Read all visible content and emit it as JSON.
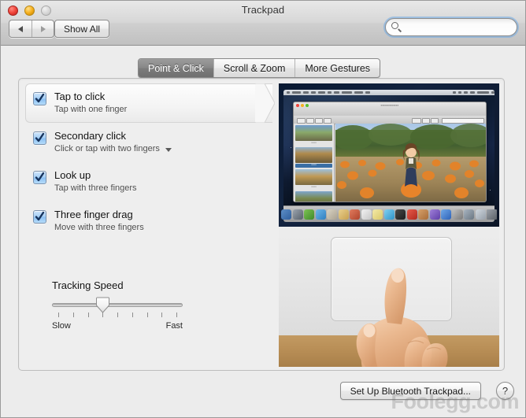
{
  "window": {
    "title": "Trackpad",
    "traffic_lights": [
      "close",
      "minimize",
      "zoom"
    ]
  },
  "toolbar": {
    "back_label": "Back",
    "forward_label": "Forward",
    "show_all_label": "Show All",
    "search": {
      "value": "",
      "placeholder": "",
      "icon": "search-icon"
    }
  },
  "tabs": [
    {
      "label": "Point & Click",
      "active": true
    },
    {
      "label": "Scroll & Zoom",
      "active": false
    },
    {
      "label": "More Gestures",
      "active": false
    }
  ],
  "options": [
    {
      "title": "Tap to click",
      "subtitle": "Tap with one finger",
      "checked": true,
      "selected": true,
      "has_popup": false
    },
    {
      "title": "Secondary click",
      "subtitle": "Click or tap with two fingers",
      "checked": true,
      "selected": false,
      "has_popup": true
    },
    {
      "title": "Look up",
      "subtitle": "Tap with three fingers",
      "checked": true,
      "selected": false,
      "has_popup": false
    },
    {
      "title": "Three finger drag",
      "subtitle": "Move with three fingers",
      "checked": true,
      "selected": false,
      "has_popup": false
    }
  ],
  "tracking_speed": {
    "label": "Tracking Speed",
    "min_label": "Slow",
    "max_label": "Fast",
    "tick_count": 9,
    "value_index": 3
  },
  "preview": {
    "top_scene": "mac-desktop-preview-app-pumpkin-patch-photo",
    "bottom_scene": "hand-tapping-magic-trackpad"
  },
  "buttons": {
    "bluetooth_label": "Set Up Bluetooth Trackpad...",
    "help_label": "?"
  },
  "watermark": "Foolegg.com",
  "colors": {
    "window_bg": "#ececec",
    "content_bg": "#eeeeee",
    "accent_checkbox": "#8cc0f2",
    "active_tab": "#7c7c7c",
    "focus_ring": "#6eaae6"
  }
}
